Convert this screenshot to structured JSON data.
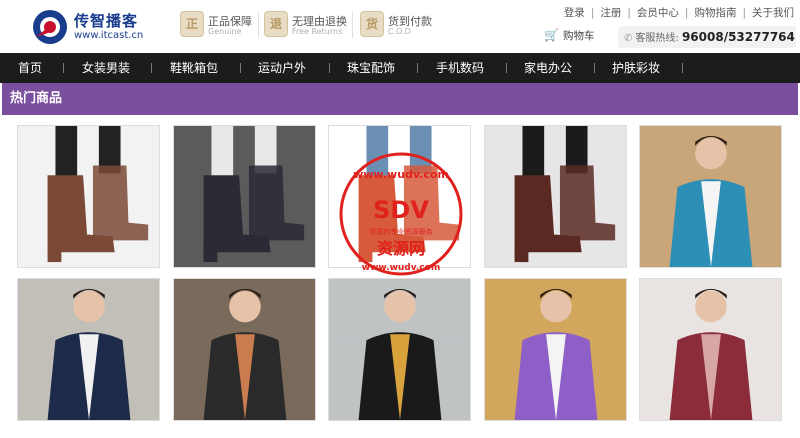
{
  "header": {
    "logo_name": "传智播客",
    "logo_url": "www.itcast.cn",
    "features": [
      {
        "title": "正品保障",
        "sub": "Genuine",
        "icon": "genuine-icon",
        "glyph": "正"
      },
      {
        "title": "无理由退换",
        "sub": "Free Returns",
        "icon": "return-icon",
        "glyph": "退"
      },
      {
        "title": "货到付款",
        "sub": "C.O.D",
        "icon": "cod-icon",
        "glyph": "货"
      }
    ],
    "top_links": [
      "登录",
      "注册",
      "会员中心",
      "购物指南",
      "关于我们"
    ],
    "cart_label": "购物车",
    "hotline_label": "客服热线:",
    "hotline_number": "96008/53277764"
  },
  "nav": {
    "items": [
      "首页",
      "女装男装",
      "鞋靴箱包",
      "运动户外",
      "珠宝配饰",
      "手机数码",
      "家电办公",
      "护肤彩妆"
    ]
  },
  "section": {
    "title": "热门商品"
  },
  "products": [
    {
      "name": "product-ankle-boots-brown",
      "palette": [
        "#f2f2f2",
        "#7a4a36",
        "#222"
      ]
    },
    {
      "name": "product-suede-boots-black",
      "palette": [
        "#5b5b5b",
        "#2c2a34",
        "#e8e8e8"
      ]
    },
    {
      "name": "product-orange-boots",
      "palette": [
        "#ffffff",
        "#d65a3b",
        "#6b8fb3"
      ]
    },
    {
      "name": "product-buckle-boots",
      "palette": [
        "#e6e6e6",
        "#5a2a22",
        "#1b1b1b"
      ]
    },
    {
      "name": "product-teal-jacket-man",
      "palette": [
        "#c9a57a",
        "#2d8fb5",
        "#f5f5f5"
      ]
    },
    {
      "name": "product-navy-cardigan-man",
      "palette": [
        "#c2beb8",
        "#1d2a4a",
        "#f1f1f1"
      ]
    },
    {
      "name": "product-scarf-leather-jacket",
      "palette": [
        "#7a6a5c",
        "#2a2a2a",
        "#c97c4e"
      ]
    },
    {
      "name": "product-black-hoodie-man",
      "palette": [
        "#bfc3c4",
        "#1a1a1a",
        "#d8a23d"
      ]
    },
    {
      "name": "product-purple-plaid-coat",
      "palette": [
        "#d2a65c",
        "#8d5fc7",
        "#f4f4f4"
      ]
    },
    {
      "name": "product-plaid-sweater-woman",
      "palette": [
        "#e9e4e2",
        "#8c2c3a",
        "#d7a6a6"
      ]
    }
  ],
  "watermark": {
    "top": "www.wudv.com",
    "main": "SDV",
    "middle": "优质的专业资源服务",
    "bottom": "资源网",
    "footer": "www.wudv.com",
    "color": "#e0211d"
  },
  "colors": {
    "nav_bg": "#1c1c1c",
    "section_bg": "#7a4f9e",
    "cart_icon": "#c8102e"
  }
}
